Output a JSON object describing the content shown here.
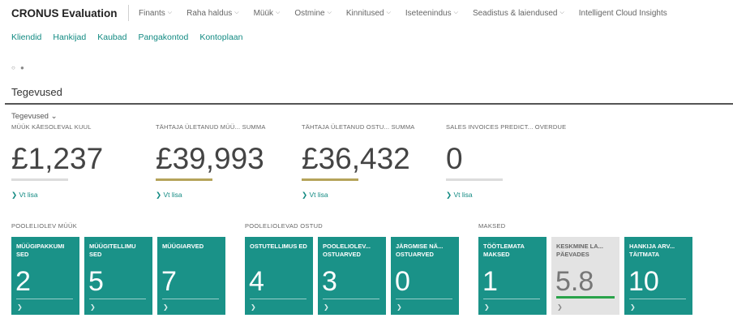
{
  "app": {
    "title": "CRONUS Evaluation"
  },
  "nav": {
    "menus": [
      "Finants",
      "Raha haldus",
      "Müük",
      "Ostmine",
      "Kinnitused",
      "Iseteenindus",
      "Seadistus & laiendused",
      "Intelligent Cloud Insights"
    ]
  },
  "quicklinks": [
    "Kliendid",
    "Hankijad",
    "Kaubad",
    "Pangakontod",
    "Kontoplaan"
  ],
  "indicator": "○ ●",
  "section": {
    "title": "Tegevused",
    "subtitle": "Tegevused ⌄"
  },
  "kpis": [
    {
      "title": "MÜÜK KÄESOLEVAL KUUL",
      "value": "£1,237",
      "bar_color": "#dcdcdc",
      "link": "❯ Vt lisa"
    },
    {
      "title": "TÄHTAJA ÜLETANUD MÜÜ... SUMMA",
      "value": "£39,993",
      "bar_color": "#b5a35a",
      "link": "❯ Vt lisa"
    },
    {
      "title": "TÄHTAJA ÜLETANUD OSTU... SUMMA",
      "value": "£36,432",
      "bar_color": "#b5a35a",
      "link": "❯ Vt lisa"
    },
    {
      "title": "SALES INVOICES PREDICT... OVERDUE",
      "value": "0",
      "bar_color": "#dcdcdc",
      "link": "❯ Vt lisa"
    }
  ],
  "groups": [
    {
      "label": "POOLELIOLEV MÜÜK",
      "tiles": [
        {
          "title": "MÜÜGIPAKKUMI SED",
          "value": "2"
        },
        {
          "title": "MÜÜGITELLIMU SED",
          "value": "5"
        },
        {
          "title": "MÜÜGIARVED",
          "value": "7"
        }
      ]
    },
    {
      "label": "POOLELIOLEVAD OSTUD",
      "tiles": [
        {
          "title": "OSTUTELLIMUS ED",
          "value": "4"
        },
        {
          "title": "POOLELIOLEV... OSTUARVED",
          "value": "3"
        },
        {
          "title": "JÄRGMISE NÄ... OSTUARVED",
          "value": "0"
        }
      ]
    },
    {
      "label": "MAKSED",
      "tiles": [
        {
          "title": "TÖÖTLEMATA MAKSED",
          "value": "1"
        },
        {
          "title": "KESKMINE LA... PÄEVADES",
          "value": "5.8"
        },
        {
          "title": "HANKIJA ARV... TÄITMATA",
          "value": "10"
        }
      ]
    }
  ],
  "tile_arrow": "❯",
  "colors": {
    "tile": "#1a9288",
    "tile_light": "#e3e3e3",
    "accent": "#128a82",
    "gold_bar": "#b5a35a",
    "green_bar": "#2aa34a"
  }
}
